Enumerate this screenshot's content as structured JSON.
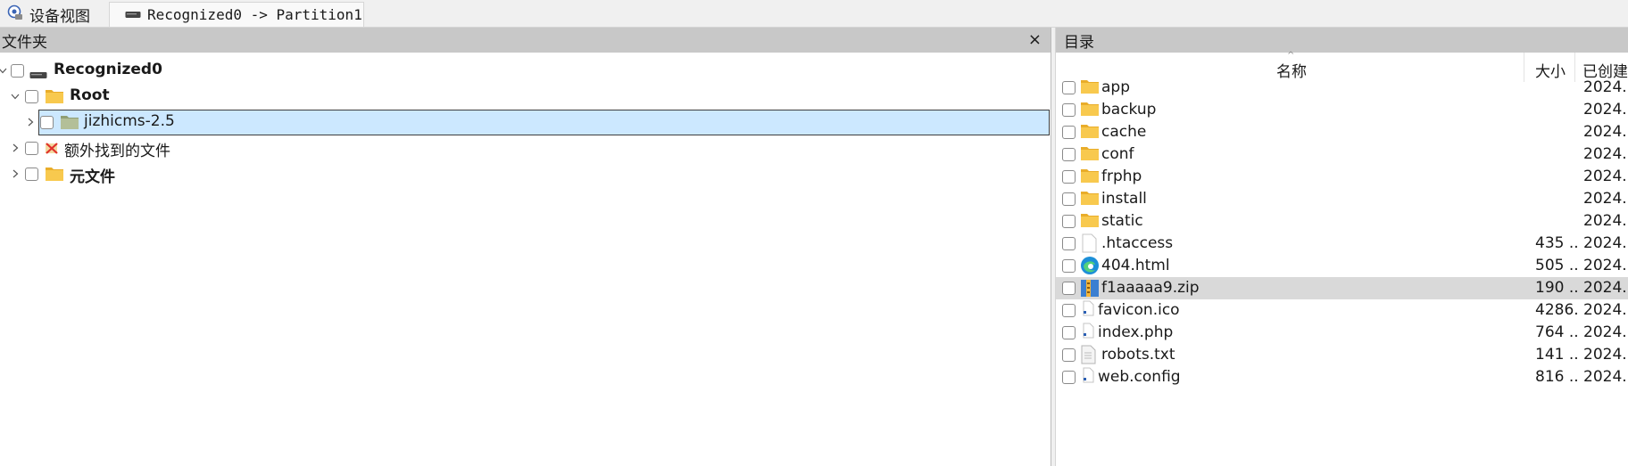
{
  "tabs": [
    {
      "label": "设备视图",
      "icon": "device-view-icon"
    },
    {
      "label": "Recognized0 -> Partition1",
      "icon": "drive-icon"
    }
  ],
  "left_pane": {
    "title": "文件夹",
    "close_glyph": "×",
    "tree": [
      {
        "label": "Recognized0",
        "icon": "drive-icon",
        "bold": true,
        "expanded": true
      },
      {
        "label": "Root",
        "icon": "folder-icon",
        "bold": true,
        "expanded": true
      },
      {
        "label": "jizhicms-2.5",
        "icon": "folder-icon",
        "bold": false,
        "expanded": false,
        "selected": true
      },
      {
        "label": "额外找到的文件",
        "icon": "extra-files-icon",
        "bold": false,
        "expanded": false
      },
      {
        "label": "元文件",
        "icon": "folder-icon",
        "bold": true,
        "expanded": false
      }
    ]
  },
  "right_pane": {
    "title": "目录",
    "columns": {
      "name": "名称",
      "size": "大小",
      "created": "已创建"
    },
    "files": [
      {
        "name": "app",
        "icon": "folder-icon",
        "size": "",
        "created": "2024..."
      },
      {
        "name": "backup",
        "icon": "folder-icon",
        "size": "",
        "created": "2024..."
      },
      {
        "name": "cache",
        "icon": "folder-icon",
        "size": "",
        "created": "2024..."
      },
      {
        "name": "conf",
        "icon": "folder-icon",
        "size": "",
        "created": "2024..."
      },
      {
        "name": "frphp",
        "icon": "folder-icon",
        "size": "",
        "created": "2024..."
      },
      {
        "name": "install",
        "icon": "folder-icon",
        "size": "",
        "created": "2024..."
      },
      {
        "name": "static",
        "icon": "folder-icon",
        "size": "",
        "created": "2024..."
      },
      {
        "name": ".htaccess",
        "icon": "blank-file-icon",
        "size": "435 ...",
        "created": "2024..."
      },
      {
        "name": "404.html",
        "icon": "edge-browser-icon",
        "size": "505 ...",
        "created": "2024..."
      },
      {
        "name": "f1aaaaa9.zip",
        "icon": "zip-archive-icon",
        "size": "190 ...",
        "created": "2024...",
        "highlighted": true
      },
      {
        "name": "favicon.ico",
        "icon": "small-file-icon",
        "size": "4286...",
        "created": "2024..."
      },
      {
        "name": "index.php",
        "icon": "small-file-icon",
        "size": "764 ...",
        "created": "2024..."
      },
      {
        "name": "robots.txt",
        "icon": "text-file-icon",
        "size": "141 ...",
        "created": "2024..."
      },
      {
        "name": "web.config",
        "icon": "small-file-icon",
        "size": "816 ...",
        "created": "2024..."
      }
    ]
  },
  "colors": {
    "pane_header_bg": "#c8c8c8",
    "selection_bg": "#cce8ff",
    "row_highlight": "#d9d9d9",
    "folder_yellow": "#f8c94e"
  }
}
